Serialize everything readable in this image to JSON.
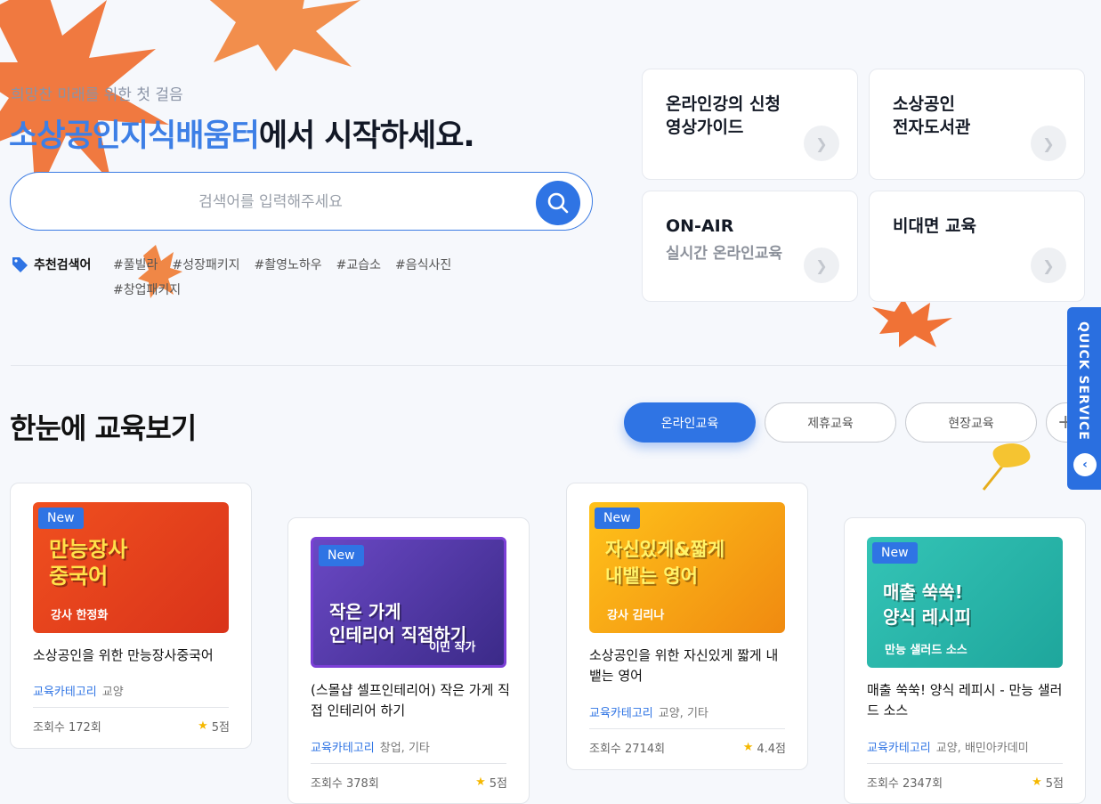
{
  "hero": {
    "subtitle": "희망찬 미래를 위한 첫 걸음",
    "title_accent": "소상공인지식배움터",
    "title_rest": "에서 시작하세요."
  },
  "search": {
    "placeholder": "검색어를 입력해주세요",
    "value": ""
  },
  "recommended": {
    "label": "추천검색어",
    "tags": [
      "#풀빌라",
      "#성장패키지",
      "#촬영노하우",
      "#교습소",
      "#음식사진",
      "#창업패키지"
    ]
  },
  "quick_cards": [
    {
      "title": "온라인강의 신청\n영상가이드",
      "subtitle": ""
    },
    {
      "title": "소상공인\n전자도서관",
      "subtitle": ""
    },
    {
      "title": "ON-AIR",
      "subtitle": "실시간 온라인교육"
    },
    {
      "title": "비대면 교육",
      "subtitle": ""
    }
  ],
  "section": {
    "title": "한눈에 교육보기",
    "tabs": [
      "온라인교육",
      "제휴교육",
      "현장교육"
    ],
    "more": "+"
  },
  "quick_service": {
    "label": "QUICK SERVICE",
    "button": "‹"
  },
  "cards": [
    {
      "badge": "New",
      "thumb_title": "만능장사\n중국어",
      "thumb_sub": "강사 한정화",
      "thumb_color": "#e8431c",
      "title": "소상공인을 위한 만능장사중국어",
      "category_label": "교육카테고리",
      "category_value": "교양",
      "views": "조회수 172회",
      "score": "5점"
    },
    {
      "badge": "New",
      "thumb_title": "작은 가게\n인테리어 직접하기",
      "thumb_sub": "이민 작가",
      "thumb_color": "#5a3fa8",
      "title": "(스몰샵 셀프인테리어) 작은 가게 직접 인테리어 하기",
      "category_label": "교육카테고리",
      "category_value": "창업, 기타",
      "views": "조회수 378회",
      "score": "5점"
    },
    {
      "badge": "New",
      "thumb_title": "자신있게&짧게\n내뱉는 영어",
      "thumb_sub": "강사 김리나",
      "thumb_color": "#f6a416",
      "title": "소상공인을 위한 자신있게 짧게 내뱉는 영어",
      "category_label": "교육카테고리",
      "category_value": "교양, 기타",
      "views": "조회수 2714회",
      "score": "4.4점"
    },
    {
      "badge": "New",
      "thumb_title": "매출 쑥쑥!\n양식 레시피",
      "thumb_sub": "만능 샐러드 소스",
      "thumb_color": "#2bb8b0",
      "title": "매출 쑥쑥! 양식 레피시 - 만능 샐러드 소스",
      "category_label": "교육카테고리",
      "category_value": "교양, 배민아카데미",
      "views": "조회수 2347회",
      "score": "5점"
    }
  ],
  "colors": {
    "accent": "#2f74e4",
    "leaf": "#ef6a2b",
    "ginkgo": "#f5c431"
  }
}
